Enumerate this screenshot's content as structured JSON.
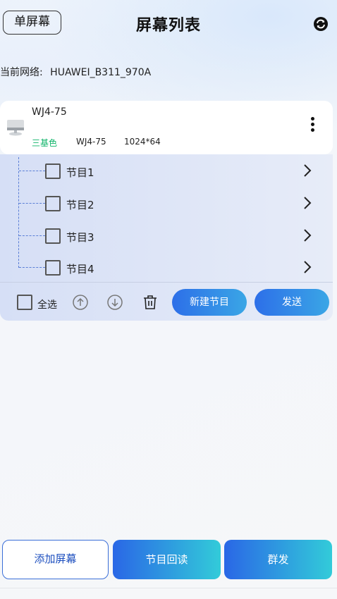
{
  "header": {
    "single_screen_label": "单屏幕",
    "title": "屏幕列表",
    "refresh_icon": "refresh-icon"
  },
  "network": {
    "label": "当前网络:",
    "ssid": "HUAWEI_B311_970A"
  },
  "screen": {
    "name": "WJ4-75",
    "color_type": "三基色",
    "model": "WJ4-75",
    "resolution": "1024*64",
    "icon": "screen-icon",
    "more_icon": "more-vertical-icon"
  },
  "programs": [
    {
      "label": "节目1"
    },
    {
      "label": "节目2"
    },
    {
      "label": "节目3"
    },
    {
      "label": "节目4"
    }
  ],
  "toolbar": {
    "select_all_label": "全选",
    "move_up_icon": "arrow-up-circle-icon",
    "move_down_icon": "arrow-down-circle-icon",
    "delete_icon": "trash-icon",
    "new_program_label": "新建节目",
    "send_label": "发送"
  },
  "bottom": {
    "add_screen_label": "添加屏幕",
    "program_readback_label": "节目回读",
    "group_send_label": "群发"
  },
  "colors": {
    "accent_blue": "#2d6fe8",
    "accent_cyan": "#32cbd9",
    "tag_green": "#10b46a"
  }
}
